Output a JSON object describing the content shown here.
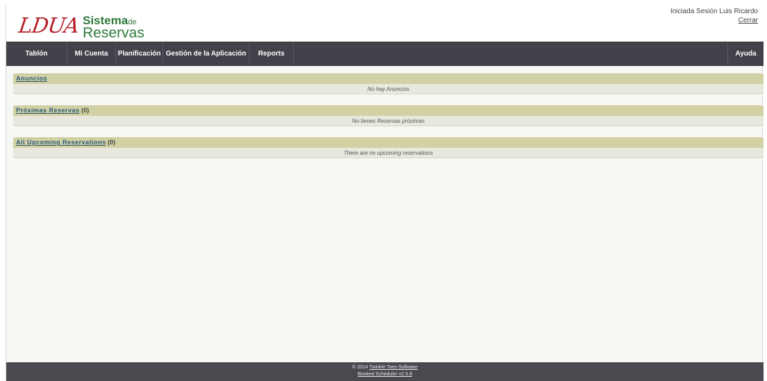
{
  "header": {
    "logo_mark": "LDUA",
    "logo_line1_main": "Sistema",
    "logo_line1_small": "de",
    "logo_line2": "Reservas",
    "session_text": "Iniciada Sesión Luis Ricardo",
    "logout_label": "Cerrar"
  },
  "nav": {
    "items": [
      {
        "label": "Tablón"
      },
      {
        "label": "Mi Cuenta"
      },
      {
        "label": "Planificación"
      },
      {
        "label": "Gestión de la Aplicación"
      },
      {
        "label": "Reports"
      }
    ],
    "help_label": "Ayuda"
  },
  "panels": [
    {
      "title": "Anuncios",
      "count": "",
      "empty_text": "No hay Anuncios"
    },
    {
      "title": "Próximas Reservas",
      "count": "(0)",
      "empty_text": "No tienes Reservas próximas"
    },
    {
      "title": "All Upcoming Reservations",
      "count": "(0)",
      "empty_text": "There are no upcoming reservations"
    }
  ],
  "footer": {
    "copyright_prefix": "© 2014",
    "company_link": "Twinkle Toes Software",
    "version_link": "Booked Scheduler v2.5.8"
  },
  "colors": {
    "nav_bg": "#43424a",
    "panel_header_bg": "#d2d1a4",
    "logo_red": "#b5202a",
    "logo_green": "#2f7a3b"
  }
}
